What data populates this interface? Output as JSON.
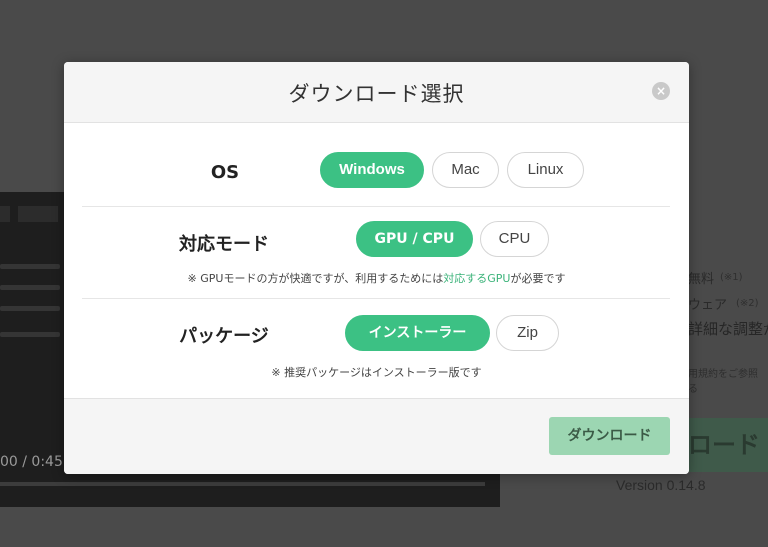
{
  "background": {
    "video_time": "00 / 0:45",
    "right_lines": [
      "無料",
      "(※1)",
      "ウェア",
      "(※2)",
      "詳細な調整が",
      "用規約をご参照",
      "る",
      "ロード"
    ],
    "version": "Version 0.14.8"
  },
  "modal": {
    "title": "ダウンロード選択",
    "close_icon": "×",
    "os": {
      "label": "OS",
      "options": [
        "Windows",
        "Mac",
        "Linux"
      ],
      "selected": "Windows"
    },
    "mode": {
      "label": "対応モード",
      "options": [
        "GPU / CPU",
        "CPU"
      ],
      "selected": "GPU / CPU",
      "note_prefix": "※ GPUモードの方が快適ですが、利用するためには",
      "note_link": "対応するGPU",
      "note_suffix": "が必要です"
    },
    "package": {
      "label": "パッケージ",
      "options": [
        "インストーラー",
        "Zip"
      ],
      "selected": "インストーラー",
      "note": "※ 推奨パッケージはインストーラー版です"
    },
    "download_label": "ダウンロード"
  },
  "colors": {
    "accent": "#3cc184",
    "download_button": "#9cd6b2",
    "overlay": "#4a4a4a"
  }
}
